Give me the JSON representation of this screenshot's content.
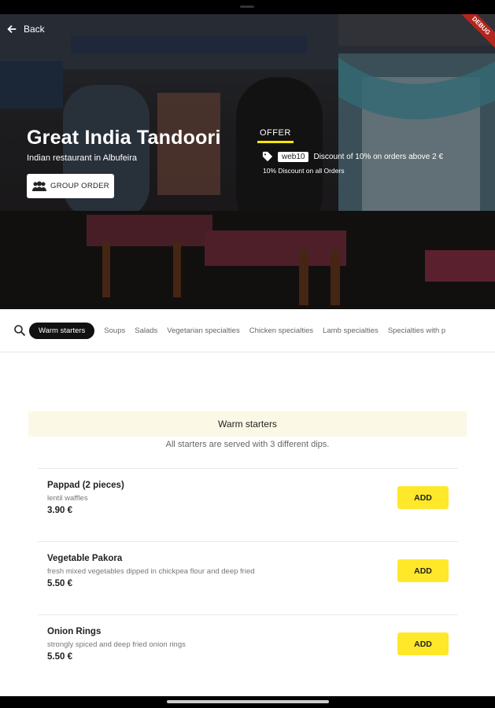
{
  "header": {
    "back_label": "Back",
    "debug_badge": "DEBUG"
  },
  "restaurant": {
    "name": "Great India Tandoori",
    "subtitle": "Indian restaurant in Albufeira",
    "group_order_label": "GROUP ORDER"
  },
  "offer": {
    "title": "OFFER",
    "coupon_code": "web10",
    "description": "Discount of 10% on orders above 2 €",
    "note": "10% Discount on all Orders"
  },
  "categories": {
    "active": "Warm starters",
    "items": [
      "Soups",
      "Salads",
      "Vegetarian specialties",
      "Chicken specialties",
      "Lamb specialties",
      "Specialties with p"
    ]
  },
  "section": {
    "title": "Warm starters",
    "note": "All starters are served with 3 different dips."
  },
  "menu_items": [
    {
      "name": "Pappad (2 pieces)",
      "description": "lentil waffles",
      "price": "3.90 €",
      "add_label": "ADD"
    },
    {
      "name": "Vegetable Pakora",
      "description": "fresh mixed vegetables dipped in chickpea flour and deep fried",
      "price": "5.50 €",
      "add_label": "ADD"
    },
    {
      "name": "Onion Rings",
      "description": "strongly spiced and deep fried onion rings",
      "price": "5.50 €",
      "add_label": "ADD"
    }
  ],
  "colors": {
    "accent": "#ffe82a",
    "section_bg": "#fbf8e6",
    "pill_bg": "#111111"
  }
}
